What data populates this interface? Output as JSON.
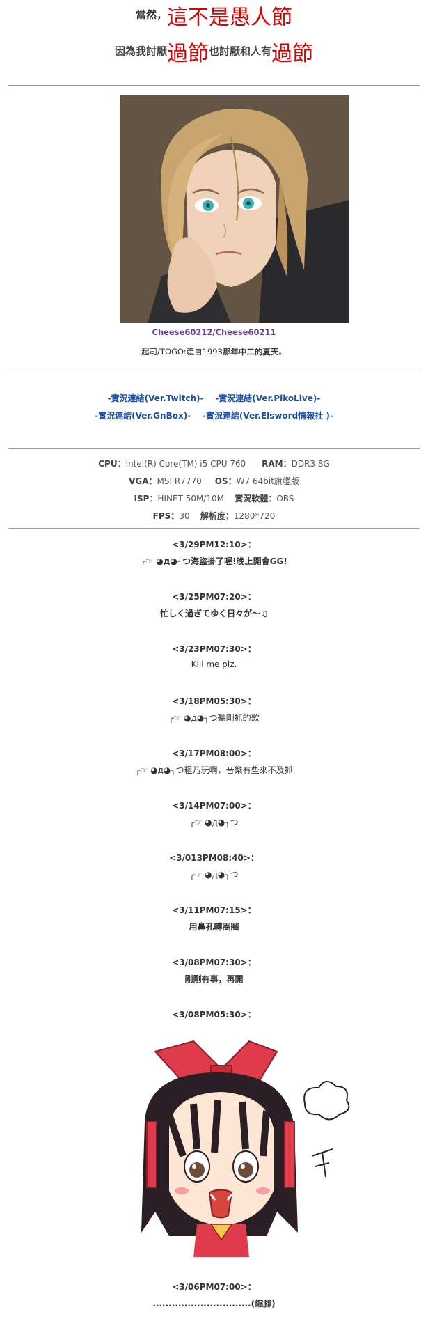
{
  "header": {
    "line1_prefix": "當然，",
    "line1_big": "這不是愚人節",
    "line2_a": "因為我討厭",
    "line2_big1": "過節",
    "line2_b": "也討厭和人有",
    "line2_big2": "過節"
  },
  "profile": {
    "name": "Cheese60212/Cheese60211",
    "desc_prefix": "起司/TOGO:產自1993",
    "desc_bold": "那年中二的夏天",
    "desc_suffix": "。"
  },
  "links": {
    "twitch": "-實況連結(Ver.Twitch)-",
    "pikolive": "-實況連結(Ver.PikoLive)-",
    "gnbox": "-實況連結(Ver.GnBox)-",
    "elsword": "-實況連結(Ver.Elsword情報社 )-"
  },
  "specs": {
    "cpu_label": "CPU：",
    "cpu_value": "Intel(R) Core(TM) i5 CPU   760",
    "ram_label": "RAM：",
    "ram_value": "DDR3 8G",
    "vga_label": "VGA：",
    "vga_value": "MSI R7770",
    "os_label": "OS：",
    "os_value": "W7 64bit旗艦版",
    "isp_label": "ISP：",
    "isp_value": "HINET 50M/10M",
    "soft_label": "實況軟體：",
    "soft_value": "OBS",
    "fps_label": "FPS：",
    "fps_value": "30",
    "res_label": "解析度：",
    "res_value": "1280*720"
  },
  "entries": [
    {
      "date": "<3/29PM12:10>：",
      "text": "╭☞ ◕д◕╮つ海盜掛了喔!晚上開會GG!"
    },
    {
      "date": "<3/25PM07:20>：",
      "text": "忙しく過ぎてゆく日々が〜♫"
    },
    {
      "date": "<3/23PM07:30>：",
      "text": "Kill me plz."
    },
    {
      "date": "<3/18PM05:30>：",
      "text": "╭☞ ◕д◕╮つ聽剛抓的歌"
    },
    {
      "date": "<3/17PM08:00>：",
      "text": "╭☞ ◕д◕╮つ粗乃玩啊，音樂有些來不及抓"
    },
    {
      "date": "<3/14PM07:00>：",
      "text": "╭☞ ◕д◕╮つ"
    },
    {
      "date": "<3/013PM08:40>：",
      "text": "╭☞ ◕д◕╮つ"
    },
    {
      "date": "<3/11PM07:15>：",
      "text": "用鼻孔轉圈圈"
    },
    {
      "date": "<3/08PM07:30>：",
      "text": "剛剛有事，再開"
    },
    {
      "date": "<3/08PM05:30>：",
      "text": ""
    },
    {
      "date": "<3/06PM07:00>：",
      "text": "...............................(縮腳)"
    }
  ],
  "colors": {
    "accent_red": "#e10000",
    "link_blue": "#1a4fa5",
    "profile_purple": "#6b3fa0",
    "rule_gray": "#9a9a9a"
  }
}
